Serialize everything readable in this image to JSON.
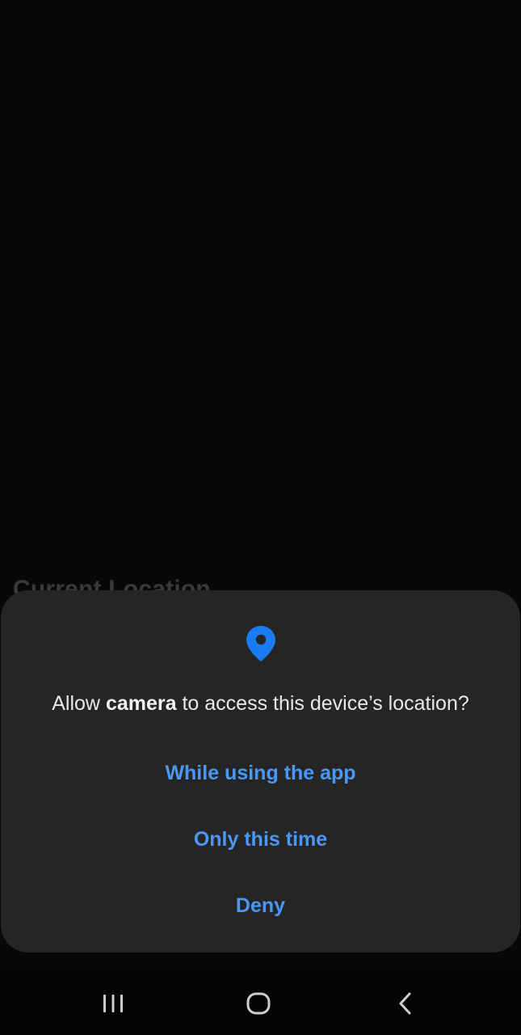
{
  "background": {
    "section_title": "Current Location"
  },
  "dialog": {
    "icon": "location-pin-icon",
    "message_prefix": "Allow ",
    "message_app": "camera",
    "message_suffix": " to access this device’s location?",
    "options": {
      "while_using": "While using the app",
      "only_this_time": "Only this time",
      "deny": "Deny"
    }
  },
  "nav_bar": {
    "recents_icon": "recents-icon",
    "home_icon": "home-icon",
    "back_icon": "back-icon"
  },
  "colors": {
    "accent": "#4a98f5",
    "pin": "#1a7cf0",
    "dialog_bg": "#252525",
    "screen_bg": "#080808"
  }
}
